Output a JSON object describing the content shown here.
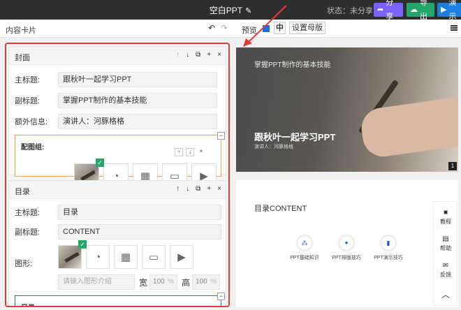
{
  "topbar": {
    "title": "空白PPT",
    "status": "状态：未分享",
    "share_label": "分享",
    "export_label": "导出",
    "present_label": "演示"
  },
  "subbar": {
    "content_cards": "内容卡片",
    "preview": "预览",
    "zh": "中",
    "master": "设置母版"
  },
  "cover": {
    "name": "封面",
    "main_label": "主标题:",
    "main_value": "跟秋叶一起学习PPT",
    "sub_label": "副标题:",
    "sub_value": "掌握PPT制作的基本技能",
    "extra_label": "额外信息:",
    "extra_value": "演讲人：河豚格格",
    "imggroup_title": "配图组:"
  },
  "toc": {
    "name": "目录",
    "main_label": "主标题:",
    "main_value": "目录",
    "sub_label": "副标题:",
    "sub_value": "CONTENT",
    "graphic_label": "图形:",
    "intro_placeholder": "请输入图形介绍",
    "width_label": "宽",
    "height_label": "高",
    "width_value": "100",
    "height_value": "100",
    "pct": "%",
    "next_title": "目录:"
  },
  "slide1": {
    "subtitle": "掌握PPT制作的基本技能",
    "title": "跟秋叶一起学习PPT",
    "presenter": "演讲人：河豚格格",
    "page": "1"
  },
  "slide2": {
    "title": "目录CONTENT",
    "items": [
      "PPT基础知识",
      "PPT排版技巧",
      "PPT演示技巧"
    ]
  },
  "side": {
    "tutorial": "教程",
    "help": "帮助",
    "feedback": "反馈"
  },
  "colors": {
    "accent": "#1a6fe0",
    "frame": "#e53935"
  }
}
